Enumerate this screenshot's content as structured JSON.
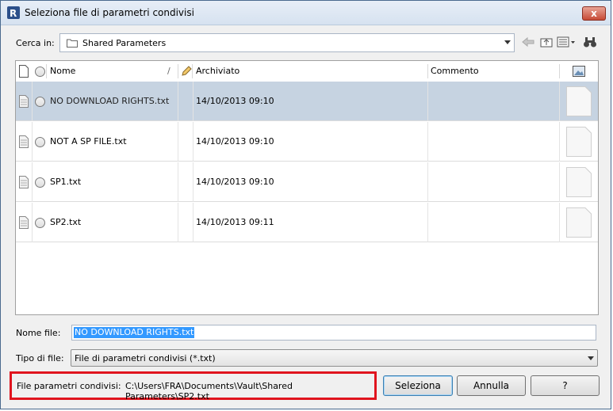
{
  "window": {
    "title": "Seleziona file di parametri condivisi",
    "close_glyph": "x"
  },
  "lookin": {
    "label": "Cerca in:",
    "value": "Shared Parameters"
  },
  "toolbar": {
    "icons": [
      "back-arrow-icon",
      "up-folder-icon",
      "views-menu-icon",
      "tools-binoculars-icon"
    ]
  },
  "columns": {
    "name": "Nome",
    "sort_glyph": "/",
    "archived": "Archiviato",
    "comment": "Commento"
  },
  "files": [
    {
      "name": "NO DOWNLOAD RIGHTS.txt",
      "archived": "14/10/2013 09:10",
      "comment": "",
      "selected": true
    },
    {
      "name": "NOT A SP FILE.txt",
      "archived": "14/10/2013 09:10",
      "comment": "",
      "selected": false
    },
    {
      "name": "SP1.txt",
      "archived": "14/10/2013 09:10",
      "comment": "",
      "selected": false
    },
    {
      "name": "SP2.txt",
      "archived": "14/10/2013 09:11",
      "comment": "",
      "selected": false
    }
  ],
  "filename": {
    "label": "Nome file:",
    "value": "NO DOWNLOAD RIGHTS.txt"
  },
  "filetype": {
    "label": "Tipo di file:",
    "value": "File di parametri condivisi (*.txt)"
  },
  "shared": {
    "label": "File parametri condivisi:",
    "path": "C:\\Users\\FRA\\Documents\\Vault\\Shared Parameters\\SP2.txt"
  },
  "buttons": {
    "select": "Seleziona",
    "cancel": "Annulla",
    "help": "?"
  },
  "colors": {
    "selected_row": "#c6d3e1",
    "highlight_border": "#e0141e",
    "selection": "#3399ff"
  }
}
